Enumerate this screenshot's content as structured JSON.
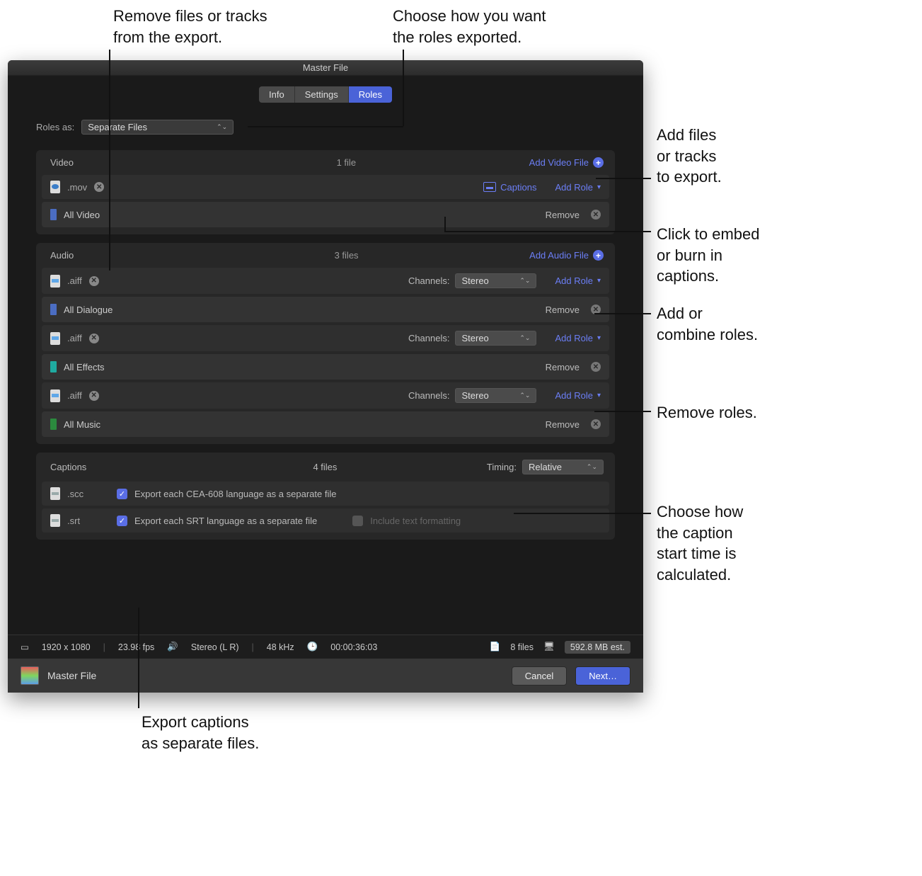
{
  "callouts": {
    "remove_files": "Remove files or tracks\nfrom the export.",
    "choose_roles_export": "Choose how you want\nthe roles exported.",
    "add_files": "Add files\nor tracks\nto export.",
    "embed_captions": "Click to embed\nor burn in\ncaptions.",
    "add_combine_roles": "Add or\ncombine roles.",
    "remove_roles": "Remove roles.",
    "caption_timing": "Choose how\nthe caption\nstart time is\ncalculated.",
    "export_captions": "Export captions\nas separate files."
  },
  "window_title": "Master File",
  "tabs": {
    "info": "Info",
    "settings": "Settings",
    "roles": "Roles"
  },
  "roles_as": {
    "label": "Roles as:",
    "value": "Separate Files"
  },
  "video": {
    "title": "Video",
    "count": "1 file",
    "add_label": "Add Video File",
    "file_ext": ".mov",
    "captions_label": "Captions",
    "add_role": "Add Role",
    "role1": {
      "name": "All Video",
      "remove": "Remove"
    }
  },
  "audio": {
    "title": "Audio",
    "count": "3 files",
    "add_label": "Add Audio File",
    "channels_label": "Channels:",
    "channels_value": "Stereo",
    "add_role": "Add Role",
    "remove": "Remove",
    "files": [
      {
        "ext": ".aiff",
        "role": "All Dialogue"
      },
      {
        "ext": ".aiff",
        "role": "All Effects"
      },
      {
        "ext": ".aiff",
        "role": "All Music"
      }
    ]
  },
  "captions": {
    "title": "Captions",
    "count": "4 files",
    "timing_label": "Timing:",
    "timing_value": "Relative",
    "rows": [
      {
        "ext": ".scc",
        "check_label": "Export each CEA-608 language as a separate file"
      },
      {
        "ext": ".srt",
        "check_label": "Export each SRT language as a separate file",
        "include_text": "Include text formatting"
      }
    ]
  },
  "status": {
    "resolution": "1920 x 1080",
    "fps": "23.98 fps",
    "audio": "Stereo (L R)",
    "khz": "48 kHz",
    "tc": "00:00:36:03",
    "files": "8 files",
    "size": "592.8 MB est."
  },
  "footer": {
    "title": "Master File",
    "cancel": "Cancel",
    "next": "Next…"
  }
}
